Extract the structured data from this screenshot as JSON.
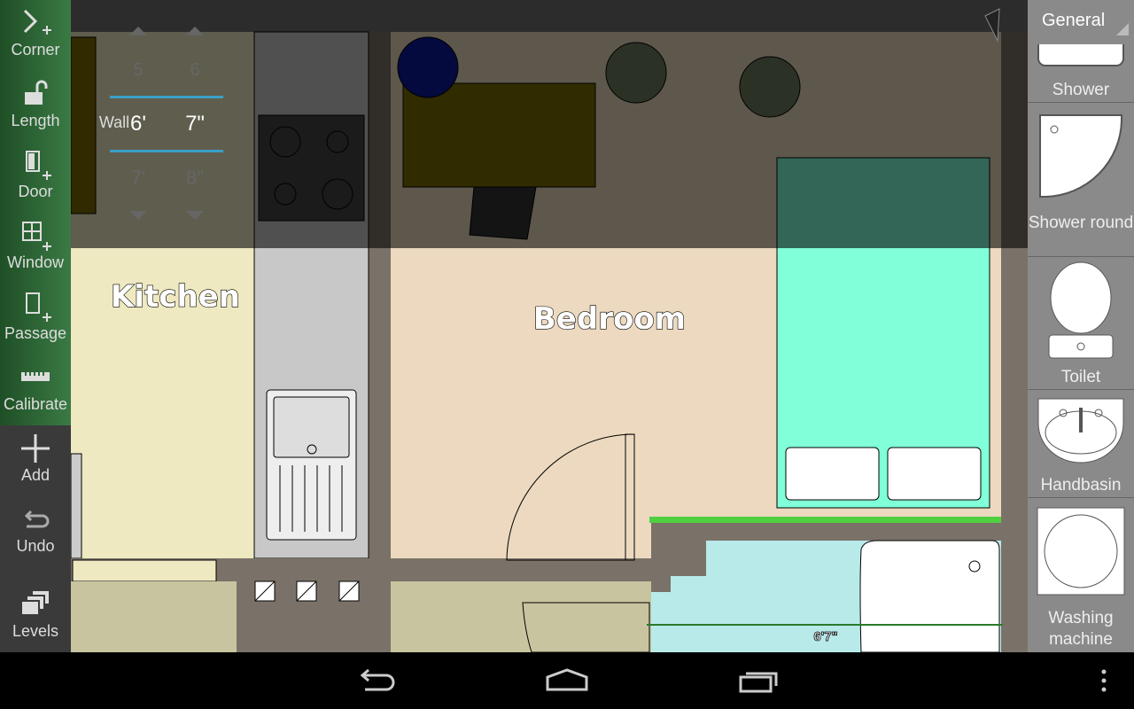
{
  "toolbar": {
    "items": [
      {
        "label": "Corner",
        "icon": "corner-add-icon"
      },
      {
        "label": "Length",
        "icon": "unlock-icon"
      },
      {
        "label": "Door",
        "icon": "door-add-icon"
      },
      {
        "label": "Window",
        "icon": "window-add-icon"
      },
      {
        "label": "Passage",
        "icon": "passage-add-icon"
      },
      {
        "label": "Calibrate",
        "icon": "ruler-icon"
      },
      {
        "label": "Add",
        "icon": "plus-icon"
      },
      {
        "label": "Undo",
        "icon": "undo-icon"
      },
      {
        "label": "Levels",
        "icon": "layers-icon"
      }
    ]
  },
  "length_picker": {
    "label": "Wall",
    "feet": {
      "prev": "5",
      "value": "6'",
      "next": "7'"
    },
    "inches": {
      "prev": "6",
      "value": "7\"",
      "next": "8\""
    }
  },
  "plan": {
    "rooms": [
      "Kitchen",
      "Bedroom"
    ],
    "dimension": "6'7\""
  },
  "library": {
    "category": "General",
    "items": [
      "Shower",
      "Shower round",
      "Toilet",
      "Handbasin",
      "Washing machine"
    ]
  },
  "colors": {
    "toolbar_green": "#2f6b3a",
    "kitchen": "#eee9c0",
    "bedroom": "#ecd9bf",
    "bed": "#80ffd8",
    "bathroom": "#b8eaea",
    "selected_wall": "#4fd040"
  }
}
